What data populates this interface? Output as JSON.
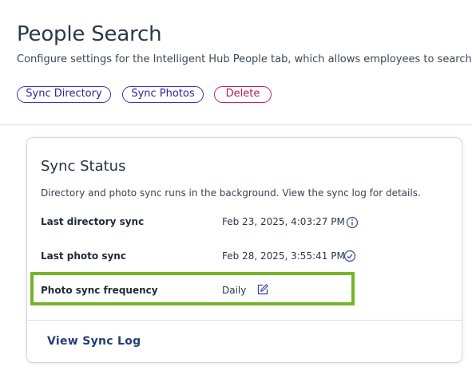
{
  "header": {
    "title": "People Search",
    "subtitle": "Configure settings for the Intelligent Hub People tab, which allows employees to search for co"
  },
  "actions": {
    "sync_directory": "Sync Directory",
    "sync_photos": "Sync Photos",
    "delete": "Delete"
  },
  "card": {
    "title": "Sync Status",
    "description": "Directory and photo sync runs in the background. View the sync log for details.",
    "rows": [
      {
        "label": "Last directory sync",
        "value": "Feb 23, 2025, 4:03:27 PM",
        "icon": "info-icon"
      },
      {
        "label": "Last photo sync",
        "value": "Feb 28, 2025, 3:55:41 PM",
        "icon": "check-circle-icon"
      },
      {
        "label": "Photo sync frequency",
        "value": "Daily",
        "icon": "edit-icon"
      }
    ],
    "view_log": "View Sync Log"
  },
  "colors": {
    "primary_outline": "#3b32c8",
    "delete_outline": "#c0245a",
    "highlight": "#72b626",
    "link": "#253e74"
  }
}
